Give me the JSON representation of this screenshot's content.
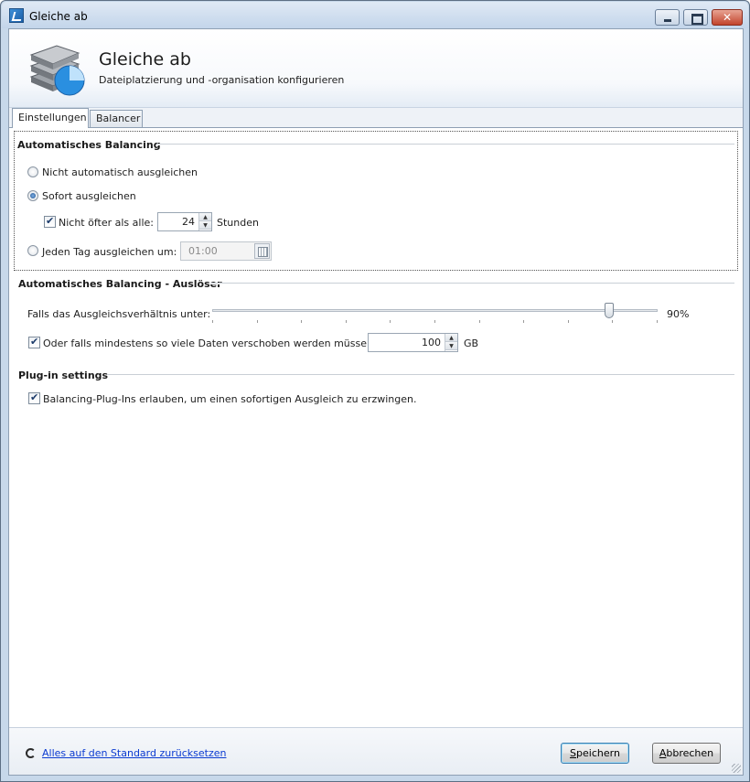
{
  "window": {
    "title": "Gleiche ab",
    "close_glyph": "✕"
  },
  "header": {
    "title": "Gleiche ab",
    "subtitle": "Dateiplatzierung und -organisation konfigurieren",
    "icon": "disk-balance-icon"
  },
  "tabs": [
    {
      "label": "Einstellungen",
      "active": true
    },
    {
      "label": "Balancer",
      "active": false
    }
  ],
  "auto_balancing": {
    "title": "Automatisches Balancing",
    "option_none": "Nicht automatisch ausgleichen",
    "option_immediate": "Sofort ausgleichen",
    "not_more_often_label": "Nicht öfter als alle:",
    "not_more_often_value": "24",
    "not_more_often_unit": "Stunden",
    "option_daily": "Jeden Tag ausgleichen um:",
    "daily_time": "01:00",
    "selected": "immediate",
    "not_more_often_checked": true
  },
  "trigger": {
    "title": "Automatisches Balancing - Auslöser",
    "ratio_label": "Falls das Ausgleichsverhältnis unter:",
    "ratio_value": "90%",
    "ratio_fraction": 0.9,
    "data_label": "Oder falls mindestens so viele Daten verschoben werden müssen:",
    "data_value": "100",
    "data_unit": "GB",
    "data_checked": true
  },
  "plugins": {
    "title": "Plug-in settings",
    "allow_label": "Balancing-Plug-Ins erlauben, um einen sofortigen Ausgleich zu erzwingen.",
    "allow_checked": true
  },
  "footer": {
    "reset_link": "Alles auf den Standard zurücksetzen",
    "save_label_underlined": "S",
    "save_label_rest": "peichern",
    "cancel_label_underlined": "A",
    "cancel_label_rest": "bbrechen"
  }
}
